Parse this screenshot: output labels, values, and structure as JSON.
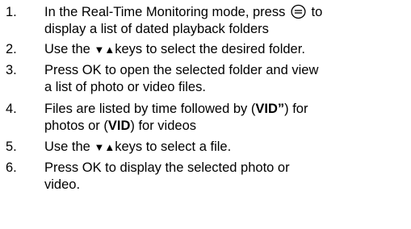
{
  "steps": [
    {
      "number": "1.",
      "text_before_icon": "In the Real-Time Monitoring mode, press ",
      "icon": "menu-button-icon",
      "text_after_icon": " to\ndisplay a list of dated playback folders"
    },
    {
      "number": "2.",
      "text_before_keys": "Use the ",
      "keys": "▼▲",
      "text_after_keys": "keys to select the desired folder."
    },
    {
      "number": "3.",
      "text": "Press OK to open  the selected folder and view\na list of photo or video files."
    },
    {
      "number": "4.",
      "text_part1": "Files are listed by time followed by (",
      "bold1": "VID”",
      "text_part2": ") for\nphotos or (",
      "bold2": "VID",
      "text_part3": ") for videos"
    },
    {
      "number": "5.",
      "text_before_keys": "Use the ",
      "keys": "▼▲",
      "text_after_keys": "keys to select a file."
    },
    {
      "number": "6.",
      "text": "Press OK to display the selected photo or\nvideo."
    }
  ]
}
